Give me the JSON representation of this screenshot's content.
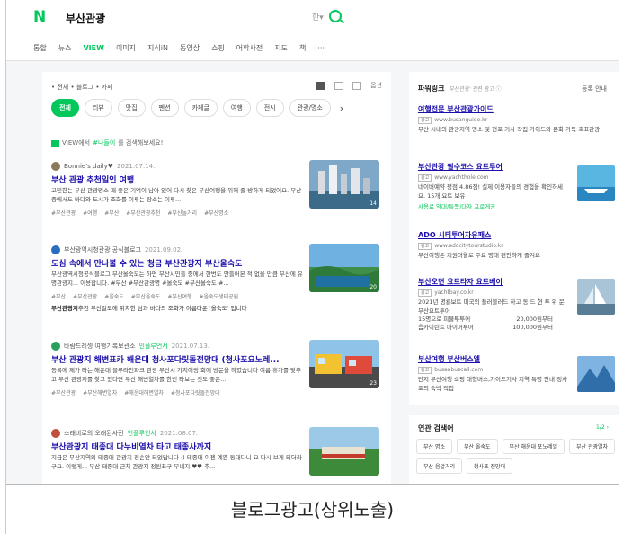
{
  "header": {
    "logo": "N",
    "query": "부산관광",
    "lang_toggle": "한▾",
    "search_icon": "search-icon"
  },
  "tabs": [
    "통합",
    "뉴스",
    "VIEW",
    "이미지",
    "지식iN",
    "동영상",
    "쇼핑",
    "어학사전",
    "지도",
    "책",
    "···"
  ],
  "main": {
    "crumb": "• 전체 • 블로그 • 카페",
    "options_label": "옵션",
    "chips": [
      "전체",
      "리뷰",
      "맛집",
      "펜션",
      "카페글",
      "여행",
      "전시",
      "관광/명소"
    ],
    "hint_prefix": "VIEW에서",
    "hint_link": "#나들이",
    "hint_suffix": "를 검색해보세요!",
    "posts": [
      {
        "source": "Bonnie's daily♥",
        "date": "2021.07.14.",
        "badge": "",
        "title": "부산 관광 추천일인 여행",
        "desc": "고민한는 부산 관광명소 때 좋은 기억이 남아 있어 다시 찾은 부산여행을 위해 줄 방하게 되었어요. 부산 중에서도 바다와 도시가 조화를 이루는 장소는 이루...",
        "tags": [
          "#부산관광",
          "#여행",
          "#부산",
          "#부산관광추천",
          "#부산놀거리",
          "#부산명소"
        ],
        "thumb_count": "14"
      },
      {
        "source": "부산광역시청관광 공식블로그",
        "date": "2021.09.02.",
        "badge": "",
        "title": "도심 속에서 만나볼 수 있는 청금 부산관광지 부산올숙도",
        "desc": "부산광역시청공식블로그 부산올숙도는 하면 부산시민들 중에서 한번도 안들어본 적 없을 만큼 부산에 유명관광지... 이용합니다. #부산 #부산관광명 #올숙도 #부산올숙도 #...",
        "tags": [
          "#부산",
          "#부산관광",
          "#올숙도",
          "#부산올숙도",
          "#부산여행",
          "#올숙도생태공원"
        ],
        "extra_bold": "부산관광지",
        "extra": "추천 부산일도에 위치한 섬과 바다의 조화가 아름다운 '올숙도' 입니다",
        "thumb_count": "20"
      },
      {
        "source": "바람드레셍 여행기록보관소",
        "date": "2021.07.13.",
        "badge": "인플루언서",
        "title": "부산 관광지 해변표카 해운대 청사포다릿돌전망대 (청사포요노레...",
        "desc": "등록에 제가 타는 해운대 블루라인파크 관광 부산시 가치어링 회에 방문을 하였습니다 여름 휴가를 맞추고 부산 관광지를 찾고 있다면 부산 해변열차를 한번 타보는 것도 좋은...",
        "tags": [
          "#부산관광",
          "#부산해변열차",
          "#해운대해변열차",
          "#청사포다릿돌전망대"
        ],
        "thumb_count": "23"
      },
      {
        "source": "소래비로의 오래된사진",
        "date": "2021.08.07.",
        "badge": "인플루언서",
        "title": "부산관광지 태종대 다누비열차 타고 태종사까지",
        "desc": "지금은 부산지역의 태종대 관광지 정손안 되었답니다 :) 태종대 이젠 예쁜 동대다니 요 다시 보게 되더라구요. 이렇게... 부산 태종대 근처 관광지 정원표구 부네지 ♥♥ 추...",
        "tags": [],
        "thumb_count": ""
      }
    ]
  },
  "sidebar": {
    "title": "파워링크",
    "subtitle": "'부산관광' 관련 광고 ⓘ",
    "register": "등록 안내",
    "ads": [
      {
        "title": "여행전문 부산관광가이드",
        "url": "www.busanguide.kr",
        "desc": "부산 시내의 관광지역 명소 및 현포 기사 작집 가이드와 문화 가득 호표관광"
      },
      {
        "title": "부산관광 필수코스 요트투어",
        "url": "www.yachthole.com",
        "desc": "네이버예약 평점 4.86점! 실제 이용자들의 경험을 확인하세요. 15개 요트 보유",
        "links": "사용료 약대/특쪽/다자 프로게공"
      },
      {
        "title": "ADO 시티투어자유패스",
        "url": "www.adocitytourstudio.kr",
        "desc": "부산여행은 지원더월로 주요 명대 편안하게 즐겨요"
      },
      {
        "title": "부산오면 요트타자 요트베이",
        "url": "yachtbay.co.kr",
        "desc": "2021년 명룡보트 미국의 플러블러드 하고 동 드 현 투 위 문 부산요트투어",
        "prices": [
          [
            "15명으로 피불투투어",
            "20,000원부터"
          ],
          [
            "음카이린트 마이어투어",
            "100,000원부터"
          ]
        ]
      },
      {
        "title": "부산여행 부산버스엘",
        "url": "busanbuscall.com",
        "desc": "단지 부산여행 쇼핑 대형버스,기이드기사 지역 특명 안내 정사포의 숙박 직접"
      }
    ]
  },
  "related": {
    "title": "연관 검색어",
    "page": "1/2 ›",
    "items": [
      "부산 명소",
      "부산 올숙도",
      "부산 해운대 포노레일",
      "부산 관광열차",
      "부산 음알거리",
      "청사포 전망대"
    ]
  },
  "caption": "블로그광고(상위노출)",
  "colors": {
    "naver_green": "#03c75a",
    "link_blue": "#1a0dab"
  }
}
